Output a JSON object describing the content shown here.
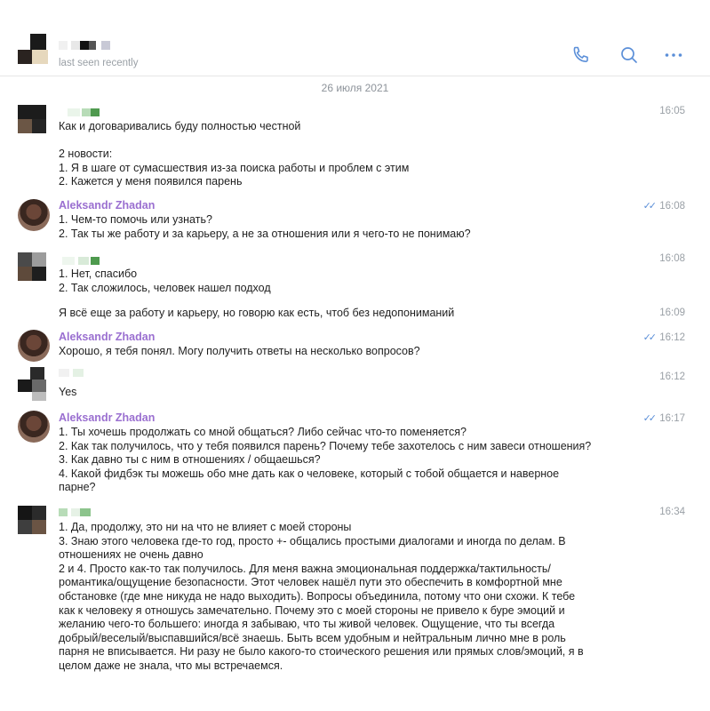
{
  "header": {
    "status": "last seen recently",
    "icons": [
      "phone-icon",
      "search-icon",
      "more-icon"
    ]
  },
  "date_separator": "26 июля 2021",
  "messages": [
    {
      "sender": "",
      "time": "16:05",
      "text": "Как и договаривались буду полностью честной\n\n2 новости:\n1. Я в шаге от сумасшествия из-за поиска работы и проблем с этим\n2. Кажется у меня появился парень"
    },
    {
      "sender": "Aleksandr Zhadan",
      "time": "16:08",
      "text": "1. Чем-то помочь или узнать?\n2. Так ты же работу и за карьеру, а не за отношения или я чего-то не понимаю?"
    },
    {
      "sender": "",
      "time": "16:08",
      "text": "1. Нет, спасибо\n2. Так сложилось, человек нашел подход"
    },
    {
      "sender": "",
      "time": "16:09",
      "text": "Я всё еще за работу и карьеру, но говорю как есть, чтоб без  недопониманий"
    },
    {
      "sender": "Aleksandr Zhadan",
      "time": "16:12",
      "text": "Хорошо, я тебя понял. Могу получить ответы на несколько вопросов?"
    },
    {
      "sender": "",
      "time": "16:12",
      "text": "Yes"
    },
    {
      "sender": "Aleksandr Zhadan",
      "time": "16:17",
      "text": "1. Ты хочешь продолжать со мной общаться? Либо сейчас что-то поменяется?\n2. Как так получилось, что у тебя появился парень? Почему тебе захотелось с ним завеси отношения?\n3. Как давно ты с ним в отношениях / общаешься?\n4. Какой фидбэк ты можешь обо мне дать как о человеке, который с тобой общается и наверное\nпарне?"
    },
    {
      "sender": "",
      "time": "16:34",
      "text": "1. Да, продолжу, это ни на что не влияет с моей стороны\n3. Знаю этого человека где-то год, просто +- общались простыми диалогами и иногда по делам. В\nотношениях не очень давно\n2 и 4. Просто как-то так получилось. Для меня важна эмоциональная поддержка/тактильность/\nромантика/ощущение безопасности. Этот человек нашёл пути это обеспечить в комфортной мне\nобстановке (где мне никуда не надо выходить). Вопросы объединила, потому что они схожи. К тебе\nкак к человеку я отношусь замечательно. Почему это с моей стороны не привело к буре эмоций и\nжеланию чего-то большего: иногда я забываю, что ты живой человек. Ощущение, что ты всегда\nдобрый/веселый/выспавшийся/всё знаешь. Быть всем удобным и нейтральным лично мне в роль\nпарня не вписывается. Ни разу не было какого-то стоического решения или прямых слов/эмоций, я в\nцелом даже не знала, что мы встречаемся."
    }
  ],
  "colors": {
    "accent": "#5b8fd8",
    "sender_name": "#9a6fd0",
    "muted": "#9aa0a6"
  }
}
